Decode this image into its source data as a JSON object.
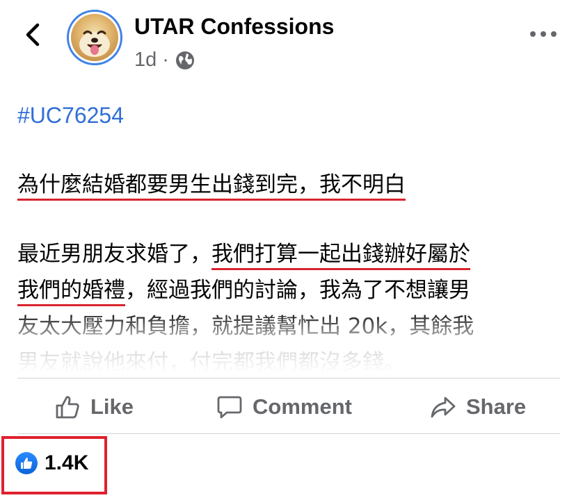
{
  "header": {
    "page_name": "UTAR Confessions",
    "time": "1d",
    "separator": "·",
    "icons": {
      "back": "back-chevron-icon",
      "audience": "globe-icon",
      "more": "more-dots-icon",
      "avatar": "shiba-dog-avatar"
    }
  },
  "post": {
    "hashtag": "#UC76254",
    "title": "為什麼結婚都要男生出錢到完，我不明白",
    "para_seg1": "最近男朋友求婚了，",
    "para_seg2": "我們打算一起出錢辦好屬於",
    "para_seg3": "我們的婚禮",
    "para_seg4": "，經過我們的討論，我為了不想讓男",
    "para_line3": "友太大壓力和負擔，就提議幫忙出 20k，其餘我",
    "para_line4": "男友就說他來付，付完都我們都沒多錢。",
    "underline_color": "#d9232e"
  },
  "actions": {
    "like_label": "Like",
    "comment_label": "Comment",
    "share_label": "Share",
    "icons": [
      "thumbs-up-icon",
      "comment-bubble-icon",
      "share-arrow-icon"
    ]
  },
  "reactions": {
    "count": "1.4K",
    "icon": "like-reaction-icon",
    "highlight_color": "#e0202e"
  },
  "colors": {
    "link_blue": "#2f6fd6",
    "secondary_text": "#65676b",
    "avatar_ring": "#3f82e6"
  }
}
